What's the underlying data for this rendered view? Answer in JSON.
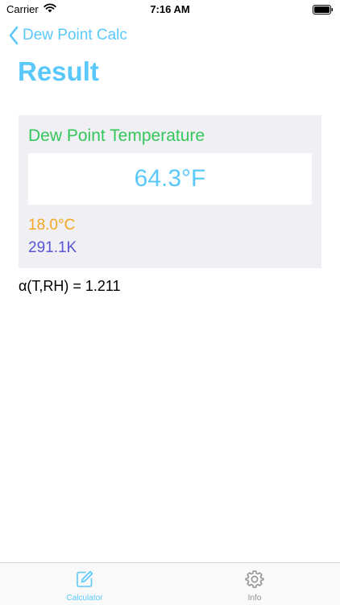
{
  "status_bar": {
    "carrier": "Carrier",
    "time": "7:16 AM"
  },
  "nav": {
    "back_label": "Dew Point Calc"
  },
  "page": {
    "title": "Result"
  },
  "result": {
    "heading": "Dew Point Temperature",
    "fahrenheit": "64.3°F",
    "celsius": "18.0°C",
    "kelvin": "291.1K"
  },
  "alpha": {
    "text": "α(T,RH) = 1.211"
  },
  "tab_bar": {
    "tabs": [
      {
        "label": "Calculator",
        "icon": "edit-icon",
        "selected": true
      },
      {
        "label": "Info",
        "icon": "gear-icon",
        "selected": false
      }
    ]
  },
  "colors": {
    "accent": "#5ac8fa",
    "heading": "#34c759",
    "celsius": "#f5a623",
    "kelvin": "#5856d6",
    "card_bg": "#efeff4",
    "tab_inactive": "#8e8e93"
  }
}
